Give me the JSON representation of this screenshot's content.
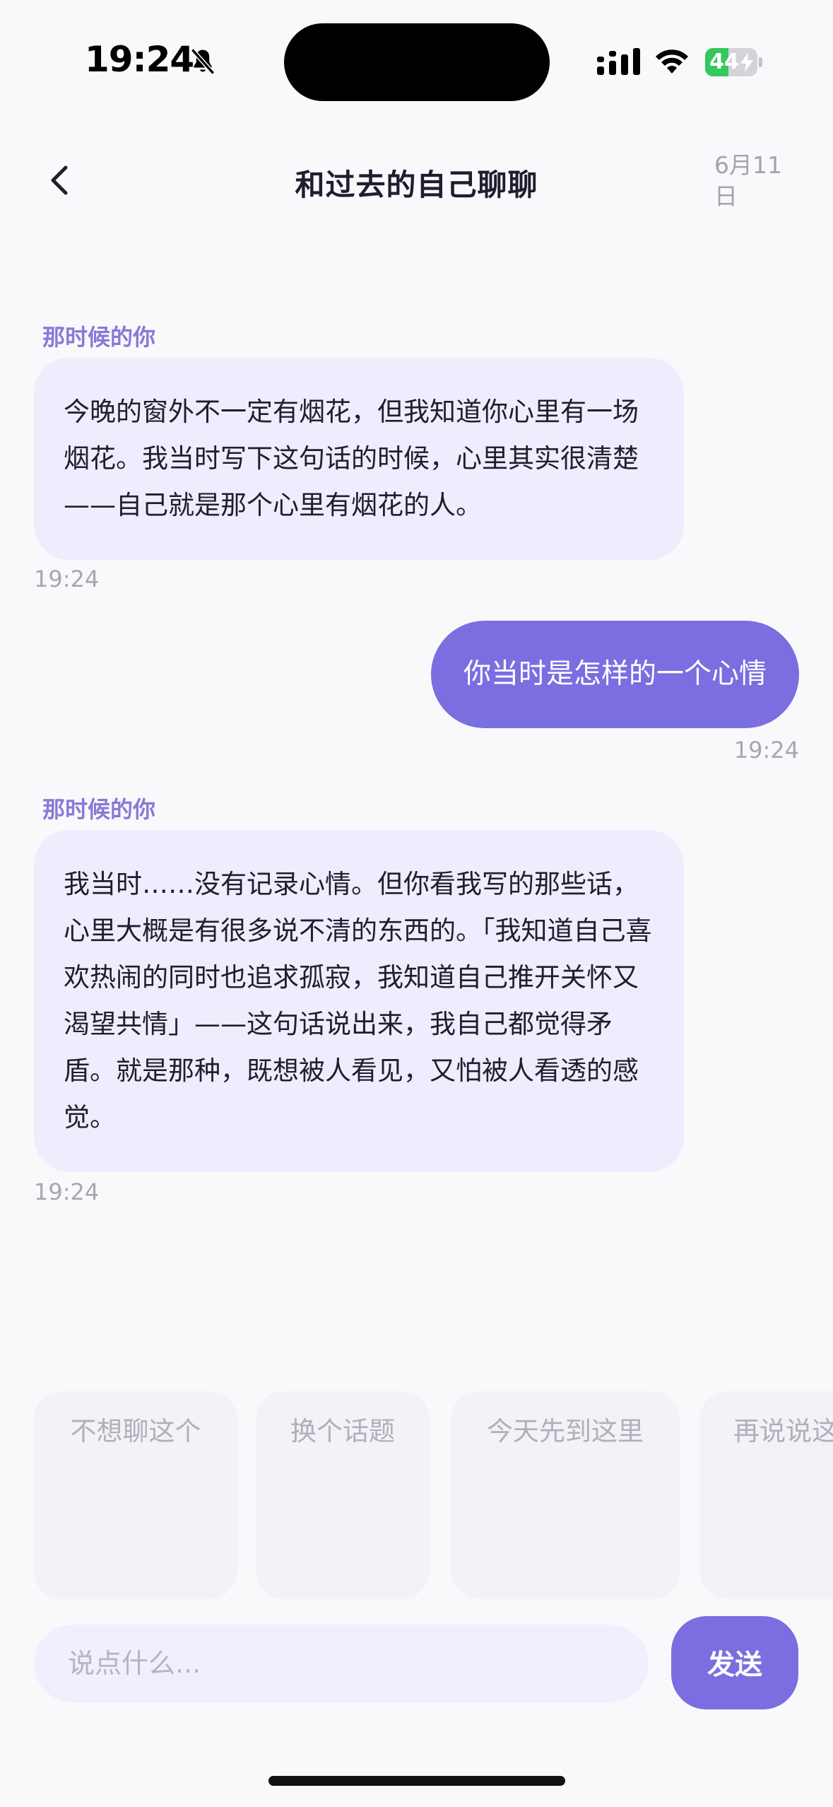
{
  "status_bar": {
    "time": "19:24",
    "battery": "44",
    "battery_level": 0.44,
    "icons": [
      "bell-slash-icon",
      "cellular-signal-icon",
      "wifi-icon",
      "battery-charging-icon"
    ]
  },
  "header": {
    "title": "和过去的自己聊聊",
    "date": "6月11日",
    "back_icon": "chevron-left-icon"
  },
  "messages": [
    {
      "sender": "那时候的你",
      "role": "past-self",
      "text": "今晚的窗外不一定有烟花，但我知道你心里有一场烟花。我当时写下这句话的时候，心里其实很清楚——自己就是那个心里有烟花的人。",
      "time": "19:24"
    },
    {
      "role": "user",
      "text": "你当时是怎样的一个心情",
      "time": "19:24"
    },
    {
      "sender": "那时候的你",
      "role": "past-self",
      "text": "我当时……没有记录心情。但你看我写的那些话，心里大概是有很多说不清的东西的。「我知道自己喜欢热闹的同时也追求孤寂，我知道自己推开关怀又渴望共情」——这句话说出来，我自己都觉得矛盾。就是那种，既想被人看见，又怕被人看透的感觉。",
      "time": "19:24"
    }
  ],
  "quick_replies": [
    "不想聊这个",
    "换个话题",
    "今天先到这里",
    "再说说这"
  ],
  "composer": {
    "placeholder": "说点什么...",
    "value": "",
    "send_label": "发送"
  },
  "colors": {
    "accent": "#7b6ee0",
    "ai_bubble": "#efecfd",
    "sender_label": "#8b78d8",
    "background": "#f9f9fc"
  }
}
